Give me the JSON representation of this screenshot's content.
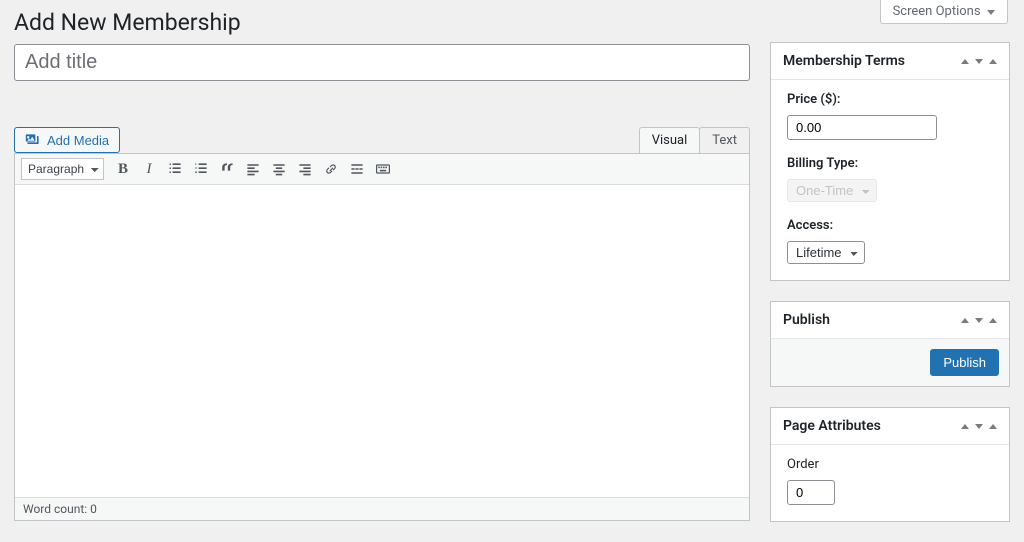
{
  "screen_options_label": "Screen Options",
  "page_title": "Add New Membership",
  "title_placeholder": "Add title",
  "add_media_label": "Add Media",
  "editor_tabs": {
    "visual": "Visual",
    "text": "Text"
  },
  "toolbar": {
    "format_label": "Paragraph"
  },
  "word_count_label": "Word count: 0",
  "sidebar": {
    "terms": {
      "title": "Membership Terms",
      "price_label": "Price ($):",
      "price_value": "0.00",
      "billing_label": "Billing Type:",
      "billing_value": "One-Time",
      "access_label": "Access:",
      "access_value": "Lifetime"
    },
    "publish": {
      "title": "Publish",
      "button": "Publish"
    },
    "page_attributes": {
      "title": "Page Attributes",
      "order_label": "Order",
      "order_value": "0"
    }
  }
}
